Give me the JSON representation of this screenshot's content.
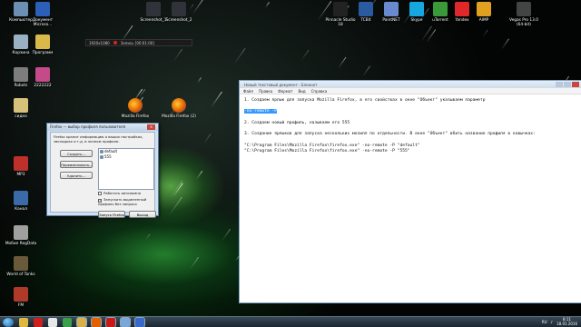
{
  "desktop_icons_left": [
    {
      "label": "Компьютер",
      "color": "#6c8fb3"
    },
    {
      "label": "Документ Microso...",
      "color": "#2b5fb8"
    },
    {
      "label": "Корзина",
      "color": "#9ab0c3"
    },
    {
      "label": "Программ",
      "color": "#d9b94a"
    },
    {
      "label": "Robots",
      "color": "#7d7d7d"
    },
    {
      "label": "2222222",
      "color": "#c54a8a"
    },
    {
      "label": "сидео",
      "color": "#d6c17a"
    },
    {
      "label": "MP3",
      "color": "#c0302a"
    },
    {
      "label": "Канал",
      "color": "#3a6aa8"
    },
    {
      "label": "Мобил RegData",
      "color": "#a0a0a0"
    },
    {
      "label": "World of Tanks",
      "color": "#6a5a3a"
    },
    {
      "label": "FM",
      "color": "#b03a2a"
    }
  ],
  "desktop_icons_top": [
    {
      "label": "Screenshot_1",
      "color": "#30343a"
    },
    {
      "label": "Screenshot_2",
      "color": "#30343a"
    },
    {
      "label": "Pinnacle Studio 18",
      "color": "#222"
    },
    {
      "label": "TCBit",
      "color": "#2a5aa0"
    },
    {
      "label": "PaintNET",
      "color": "#6a8ad0"
    },
    {
      "label": "Skype",
      "color": "#16a7e0"
    },
    {
      "label": "uTorrent",
      "color": "#3a9a3a"
    },
    {
      "label": "Yandex",
      "color": "#e0282a"
    },
    {
      "label": "AIMP",
      "color": "#e0a020"
    },
    {
      "label": "Vegas Pro 13.0 (64-bit)",
      "color": "#444"
    }
  ],
  "desktop_icons_firefox": [
    {
      "label": "Mozilla Firefox",
      "color": "#e66000"
    },
    {
      "label": "Mozilla Firefox (2)",
      "color": "#e66000"
    }
  ],
  "recorder": {
    "resolution": "1920x1080",
    "status": "Запись [00:01:00]"
  },
  "firefox_dialog": {
    "title": "Firefox — выбор профиля пользователя",
    "description": "Firefox хранит информацию о ваших настройках, закладках и т.д. в личном профиле.",
    "buttons": {
      "create": "Создать...",
      "rename": "Переименовать...",
      "delete": "Удалить..."
    },
    "profiles": [
      "default",
      "555"
    ],
    "offline_label": "Работать автономно",
    "autostart_label": "Запускать выделенный профиль без запроса",
    "start_button": "Запуск Firefox",
    "exit_button": "Выход"
  },
  "notepad": {
    "title": "Новый текстовый документ - Блокнот",
    "menu": [
      "Файл",
      "Правка",
      "Формат",
      "Вид",
      "Справка"
    ],
    "line1": "1. Создаем ярлык для запуска Mozilla Firefox, в его свойствах в окне \"Объект\" указываем параметр",
    "line2_selected": "-no-remote -P",
    "line3": "2. Создаем новый профиль, называем его 555",
    "line4": "3. Создание ярлыков для запуска нескольких мозилл по отдельности. В окне \"Объект\" вбить название профиля в кавычках:",
    "line5": "\"C:\\Program Files\\Mozilla Firefox\\firefox.exe\" -no-remote -P \"default\"",
    "line6": "\"C:\\Program Files\\Mozilla Firefox\\firefox.exe\" -no-remote -P \"555\""
  },
  "taskbar": {
    "apps": [
      {
        "name": "explorer-icon",
        "color": "#e0b840"
      },
      {
        "name": "opera-icon",
        "color": "#d0201e"
      },
      {
        "name": "yandex-icon",
        "color": "#e8e8e8"
      },
      {
        "name": "chrome-icon",
        "color": "#3aa04a"
      },
      {
        "name": "folder-icon",
        "color": "#d9b14a"
      },
      {
        "name": "firefox-icon",
        "color": "#e66000"
      },
      {
        "name": "record-icon",
        "color": "#c81818"
      },
      {
        "name": "notepad-icon",
        "color": "#7aa6d8"
      },
      {
        "name": "player-icon",
        "color": "#3a6ac8"
      }
    ],
    "language": "RU",
    "time": "8:11",
    "date": "18.01.2016"
  }
}
